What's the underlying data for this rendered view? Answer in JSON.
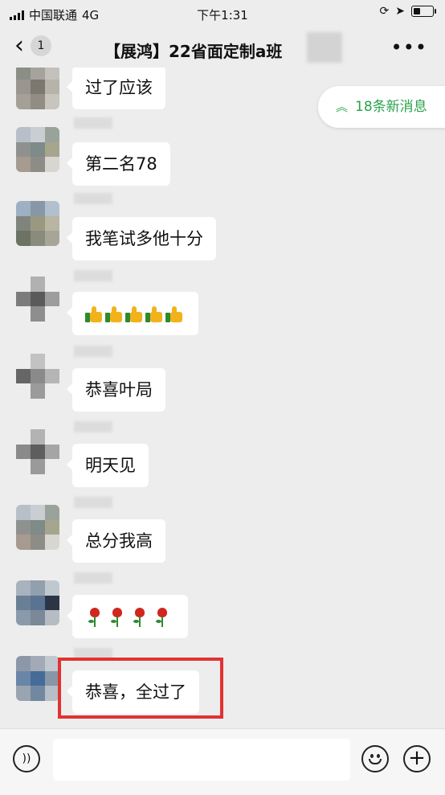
{
  "status_bar": {
    "carrier": "中国联通",
    "network": "4G",
    "time": "下午1:31"
  },
  "nav": {
    "back_count": "1",
    "title": "【展鸿】22省面定制a班",
    "more": "•••"
  },
  "new_messages": {
    "label": "18条新消息",
    "icon": "double-chevron-up-icon"
  },
  "messages": [
    {
      "text": "过了应该"
    },
    {
      "text": "第二名78"
    },
    {
      "text": "我笔试多他十分"
    },
    {
      "text": "",
      "emoji": "thumbs-up-icon x5"
    },
    {
      "text": "恭喜叶局"
    },
    {
      "text": "明天见"
    },
    {
      "text": "总分我高"
    },
    {
      "text": "",
      "emoji": "rose-icon x4"
    },
    {
      "text": "恭喜，全过了"
    }
  ],
  "colors": {
    "accent_green": "#2aa24b",
    "highlight_red": "#e23232",
    "chat_bg": "#ededed"
  }
}
